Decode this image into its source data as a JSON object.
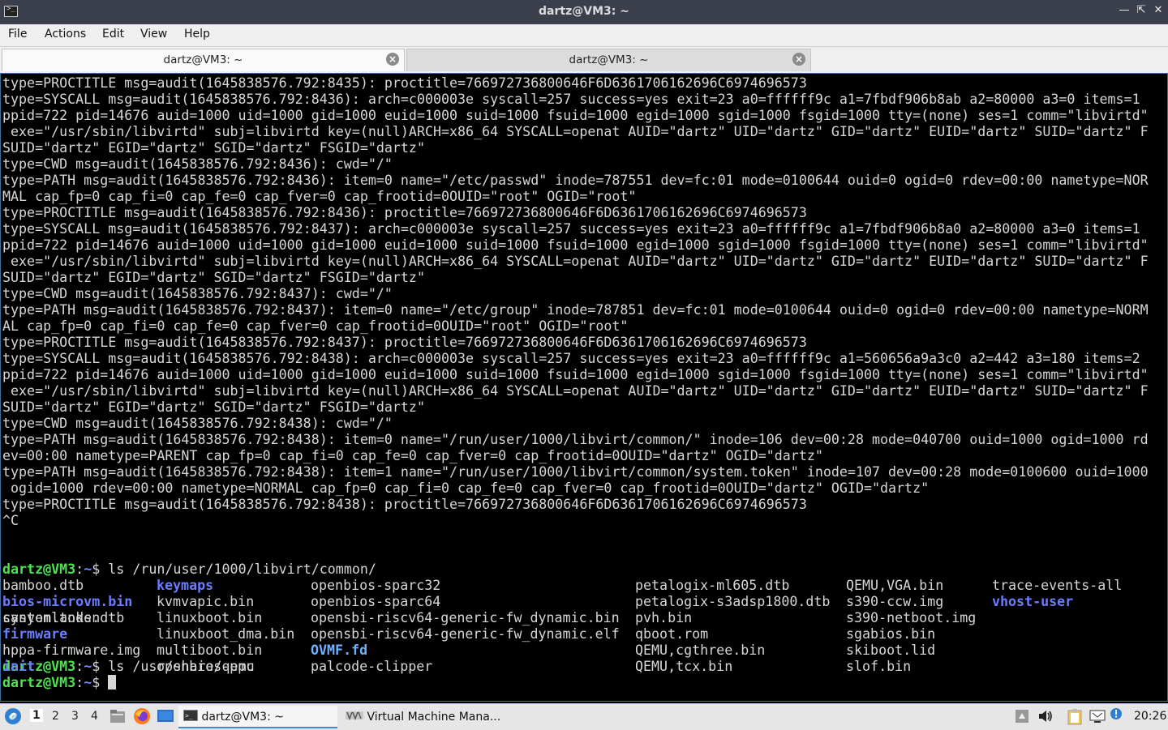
{
  "window": {
    "title": "dartz@VM3: ~",
    "menu": [
      "File",
      "Actions",
      "Edit",
      "View",
      "Help"
    ],
    "tabs": [
      {
        "label": "dartz@VM3: ~",
        "active": true
      },
      {
        "label": "dartz@VM3: ~",
        "active": false
      }
    ]
  },
  "terminal": {
    "output_lines": [
      "type=PROCTITLE msg=audit(1645838576.792:8435): proctitle=766972736800646F6D6361706162696C6974696573",
      "type=SYSCALL msg=audit(1645838576.792:8436): arch=c000003e syscall=257 success=yes exit=23 a0=ffffff9c a1=7fbdf906b8ab a2=80000 a3=0 items=1",
      "ppid=722 pid=14676 auid=1000 uid=1000 gid=1000 euid=1000 suid=1000 fsuid=1000 egid=1000 sgid=1000 fsgid=1000 tty=(none) ses=1 comm=\"libvirtd\"",
      " exe=\"/usr/sbin/libvirtd\" subj=libvirtd key=(null)ARCH=x86_64 SYSCALL=openat AUID=\"dartz\" UID=\"dartz\" GID=\"dartz\" EUID=\"dartz\" SUID=\"dartz\" F",
      "SUID=\"dartz\" EGID=\"dartz\" SGID=\"dartz\" FSGID=\"dartz\"",
      "type=CWD msg=audit(1645838576.792:8436): cwd=\"/\"",
      "type=PATH msg=audit(1645838576.792:8436): item=0 name=\"/etc/passwd\" inode=787551 dev=fc:01 mode=0100644 ouid=0 ogid=0 rdev=00:00 nametype=NOR",
      "MAL cap_fp=0 cap_fi=0 cap_fe=0 cap_fver=0 cap_frootid=0OUID=\"root\" OGID=\"root\"",
      "type=PROCTITLE msg=audit(1645838576.792:8436): proctitle=766972736800646F6D6361706162696C6974696573",
      "type=SYSCALL msg=audit(1645838576.792:8437): arch=c000003e syscall=257 success=yes exit=23 a0=ffffff9c a1=7fbdf906b8a0 a2=80000 a3=0 items=1",
      "ppid=722 pid=14676 auid=1000 uid=1000 gid=1000 euid=1000 suid=1000 fsuid=1000 egid=1000 sgid=1000 fsgid=1000 tty=(none) ses=1 comm=\"libvirtd\"",
      " exe=\"/usr/sbin/libvirtd\" subj=libvirtd key=(null)ARCH=x86_64 SYSCALL=openat AUID=\"dartz\" UID=\"dartz\" GID=\"dartz\" EUID=\"dartz\" SUID=\"dartz\" F",
      "SUID=\"dartz\" EGID=\"dartz\" SGID=\"dartz\" FSGID=\"dartz\"",
      "type=CWD msg=audit(1645838576.792:8437): cwd=\"/\"",
      "type=PATH msg=audit(1645838576.792:8437): item=0 name=\"/etc/group\" inode=787851 dev=fc:01 mode=0100644 ouid=0 ogid=0 rdev=00:00 nametype=NORM",
      "AL cap_fp=0 cap_fi=0 cap_fe=0 cap_fver=0 cap_frootid=0OUID=\"root\" OGID=\"root\"",
      "type=PROCTITLE msg=audit(1645838576.792:8437): proctitle=766972736800646F6D6361706162696C6974696573",
      "type=SYSCALL msg=audit(1645838576.792:8438): arch=c000003e syscall=257 success=yes exit=23 a0=ffffff9c a1=560656a9a3c0 a2=442 a3=180 items=2",
      "ppid=722 pid=14676 auid=1000 uid=1000 gid=1000 euid=1000 suid=1000 fsuid=1000 egid=1000 sgid=1000 fsgid=1000 tty=(none) ses=1 comm=\"libvirtd\"",
      " exe=\"/usr/sbin/libvirtd\" subj=libvirtd key=(null)ARCH=x86_64 SYSCALL=openat AUID=\"dartz\" UID=\"dartz\" GID=\"dartz\" EUID=\"dartz\" SUID=\"dartz\" F",
      "SUID=\"dartz\" EGID=\"dartz\" SGID=\"dartz\" FSGID=\"dartz\"",
      "type=CWD msg=audit(1645838576.792:8438): cwd=\"/\"",
      "type=PATH msg=audit(1645838576.792:8438): item=0 name=\"/run/user/1000/libvirt/common/\" inode=106 dev=00:28 mode=040700 ouid=1000 ogid=1000 rd",
      "ev=00:00 nametype=PARENT cap_fp=0 cap_fi=0 cap_fe=0 cap_fver=0 cap_frootid=0OUID=\"dartz\" OGID=\"dartz\"",
      "type=PATH msg=audit(1645838576.792:8438): item=1 name=\"/run/user/1000/libvirt/common/system.token\" inode=107 dev=00:28 mode=0100600 ouid=1000",
      " ogid=1000 rdev=00:00 nametype=NORMAL cap_fp=0 cap_fi=0 cap_fe=0 cap_fver=0 cap_frootid=0OUID=\"dartz\" OGID=\"dartz\"",
      "type=PROCTITLE msg=audit(1645838576.792:8438): proctitle=766972736800646F6D6361706162696C6974696573",
      "^C"
    ],
    "prompt_user": "dartz@VM3",
    "prompt_sep": ":",
    "prompt_pwd": "~",
    "prompt_sign": "$ ",
    "cmd1": "ls /run/user/1000/libvirt/common/",
    "cmd1_output": "system.token",
    "cmd2": "ls /usr/share/qemu",
    "ls_columns": [
      [
        {
          "n": "bamboo.dtb"
        },
        {
          "n": "bios-microvm.bin",
          "s": "bold"
        },
        {
          "n": "canyonlands.dtb"
        },
        {
          "n": "firmware",
          "s": "dir"
        },
        {
          "n": "hppa-firmware.img"
        },
        {
          "n": "init",
          "s": "dir"
        }
      ],
      [
        {
          "n": "keymaps",
          "s": "dir"
        },
        {
          "n": "kvmvapic.bin"
        },
        {
          "n": "linuxboot.bin"
        },
        {
          "n": "linuxboot_dma.bin"
        },
        {
          "n": "multiboot.bin"
        },
        {
          "n": "openbios-ppc"
        }
      ],
      [
        {
          "n": "openbios-sparc32"
        },
        {
          "n": "openbios-sparc64"
        },
        {
          "n": "opensbi-riscv64-generic-fw_dynamic.bin"
        },
        {
          "n": "opensbi-riscv64-generic-fw_dynamic.elf"
        },
        {
          "n": "OVMF.fd",
          "s": "ovmf"
        },
        {
          "n": "palcode-clipper"
        }
      ],
      [
        {
          "n": "petalogix-ml605.dtb"
        },
        {
          "n": "petalogix-s3adsp1800.dtb"
        },
        {
          "n": "pvh.bin"
        },
        {
          "n": "qboot.rom"
        },
        {
          "n": "QEMU,cgthree.bin"
        },
        {
          "n": "QEMU,tcx.bin"
        }
      ],
      [
        {
          "n": "QEMU,VGA.bin"
        },
        {
          "n": "s390-ccw.img"
        },
        {
          "n": "s390-netboot.img"
        },
        {
          "n": "sgabios.bin"
        },
        {
          "n": "skiboot.lid"
        },
        {
          "n": "slof.bin"
        }
      ],
      [
        {
          "n": "trace-events-all"
        },
        {
          "n": "vhost-user",
          "s": "dir"
        }
      ]
    ]
  },
  "taskbar": {
    "workspaces": [
      "1",
      "2",
      "3",
      "4"
    ],
    "tasks": [
      {
        "label": "dartz@VM3: ~",
        "active": true
      },
      {
        "label": "Virtual Machine Mana...",
        "active": false
      }
    ],
    "clock": "20:26"
  }
}
